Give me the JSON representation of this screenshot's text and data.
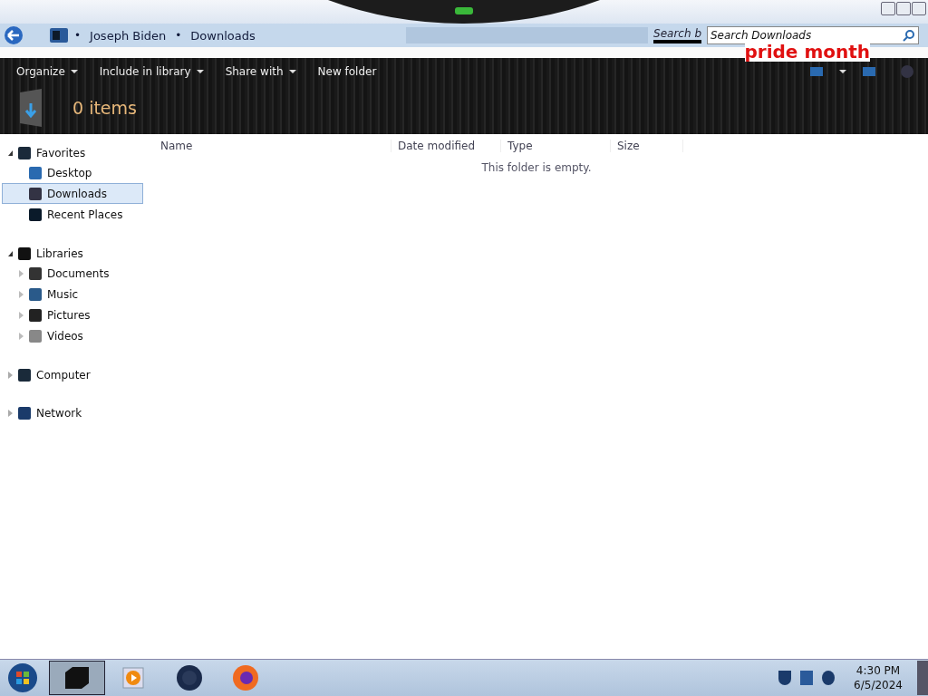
{
  "address_bar": {
    "breadcrumbs": [
      "Joseph Biden",
      "Downloads"
    ],
    "glitch_text": "Search b",
    "separator": "•"
  },
  "search": {
    "placeholder": "Search Downloads"
  },
  "overlay_text": "pride month",
  "toolbar": {
    "items": [
      {
        "label": "Organize",
        "dropdown": true
      },
      {
        "label": "Include in library",
        "dropdown": true
      },
      {
        "label": "Share with",
        "dropdown": true
      },
      {
        "label": "New folder",
        "dropdown": false
      }
    ]
  },
  "details": {
    "count": "0 items"
  },
  "sidebar": {
    "groups": [
      {
        "label": "Favorites",
        "expanded": true,
        "children": [
          {
            "label": "Desktop",
            "selected": false,
            "expandable": false
          },
          {
            "label": "Downloads",
            "selected": true,
            "expandable": false
          },
          {
            "label": "Recent Places",
            "selected": false,
            "expandable": false
          }
        ]
      },
      {
        "label": "Libraries",
        "expanded": true,
        "children": [
          {
            "label": "Documents",
            "selected": false,
            "expandable": true
          },
          {
            "label": "Music",
            "selected": false,
            "expandable": true
          },
          {
            "label": "Pictures",
            "selected": false,
            "expandable": true
          },
          {
            "label": "Videos",
            "selected": false,
            "expandable": true
          }
        ]
      },
      {
        "label": "Computer",
        "expanded": false
      },
      {
        "label": "Network",
        "expanded": false
      }
    ]
  },
  "table": {
    "columns": [
      "Name",
      "Date modified",
      "Type",
      "Size"
    ],
    "empty_message": "This folder is empty."
  },
  "taskbar": {
    "items": [
      {
        "kind": "explorer",
        "selected": true
      },
      {
        "kind": "media",
        "selected": false
      },
      {
        "kind": "globe",
        "selected": false
      },
      {
        "kind": "browser",
        "selected": false
      }
    ],
    "clock": {
      "time": "4:30 PM",
      "date": "6/5/2024"
    }
  }
}
